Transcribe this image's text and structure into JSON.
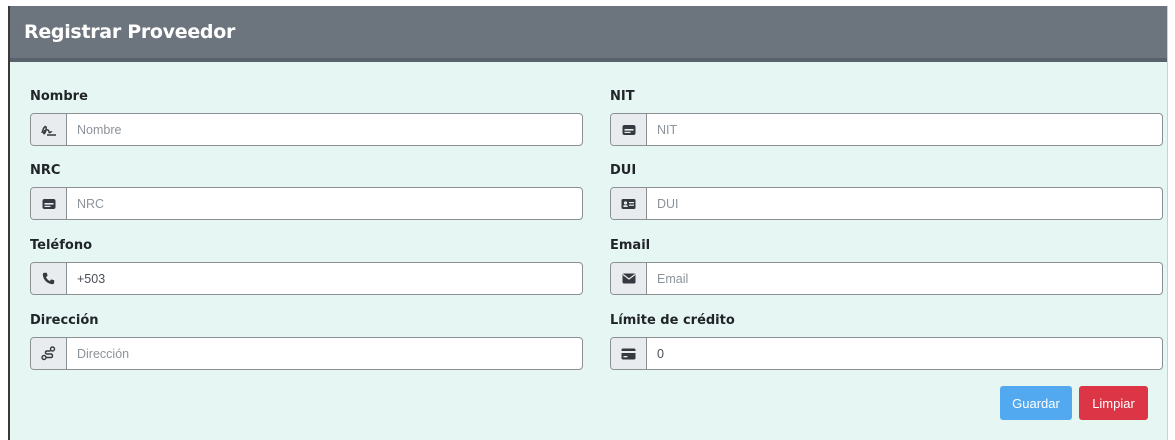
{
  "header": {
    "title": "Registrar Proveedor"
  },
  "form": {
    "nombre": {
      "label": "Nombre",
      "placeholder": "Nombre",
      "value": "",
      "icon": "signature-icon"
    },
    "nit": {
      "label": "NIT",
      "placeholder": "NIT",
      "value": "",
      "icon": "id-card-icon"
    },
    "nrc": {
      "label": "NRC",
      "placeholder": "NRC",
      "value": "",
      "icon": "id-card-icon"
    },
    "dui": {
      "label": "DUI",
      "placeholder": "DUI",
      "value": "",
      "icon": "address-card-icon"
    },
    "telefono": {
      "label": "Teléfono",
      "placeholder": "",
      "value": "+503",
      "icon": "phone-icon"
    },
    "email": {
      "label": "Email",
      "placeholder": "Email",
      "value": "",
      "icon": "envelope-icon"
    },
    "direccion": {
      "label": "Dirección",
      "placeholder": "Dirección",
      "value": "",
      "icon": "route-icon"
    },
    "limite": {
      "label": "Límite de crédito",
      "placeholder": "",
      "value": "0",
      "icon": "credit-card-icon"
    }
  },
  "actions": {
    "save_label": "Guardar",
    "clear_label": "Limpiar"
  },
  "colors": {
    "header": "#6c757d",
    "background": "#e6f6f3",
    "save": "#52a9f0",
    "clear": "#dc3545"
  }
}
